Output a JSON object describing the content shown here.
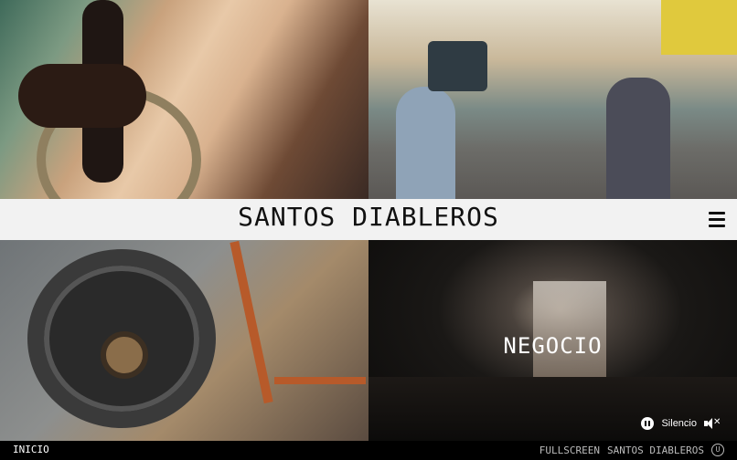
{
  "header": {
    "site_title": "SANTOS DIABLEROS"
  },
  "tiles": {
    "bottom_right_label": "NEGOCIO"
  },
  "sound": {
    "status_label": "Silencio"
  },
  "footer": {
    "inicio_label": "INICIO",
    "fullscreen_label": "FULLSCREEN",
    "brand_label": "SANTOS DIABLEROS"
  },
  "icons": {
    "menu": "hamburger-menu-icon",
    "pause": "pause-icon",
    "mute": "mute-icon",
    "brand": "brand-logo-icon"
  },
  "colors": {
    "header_bg": "#f2f2f2",
    "footer_bg": "#000000",
    "text_light": "#ffffff"
  }
}
